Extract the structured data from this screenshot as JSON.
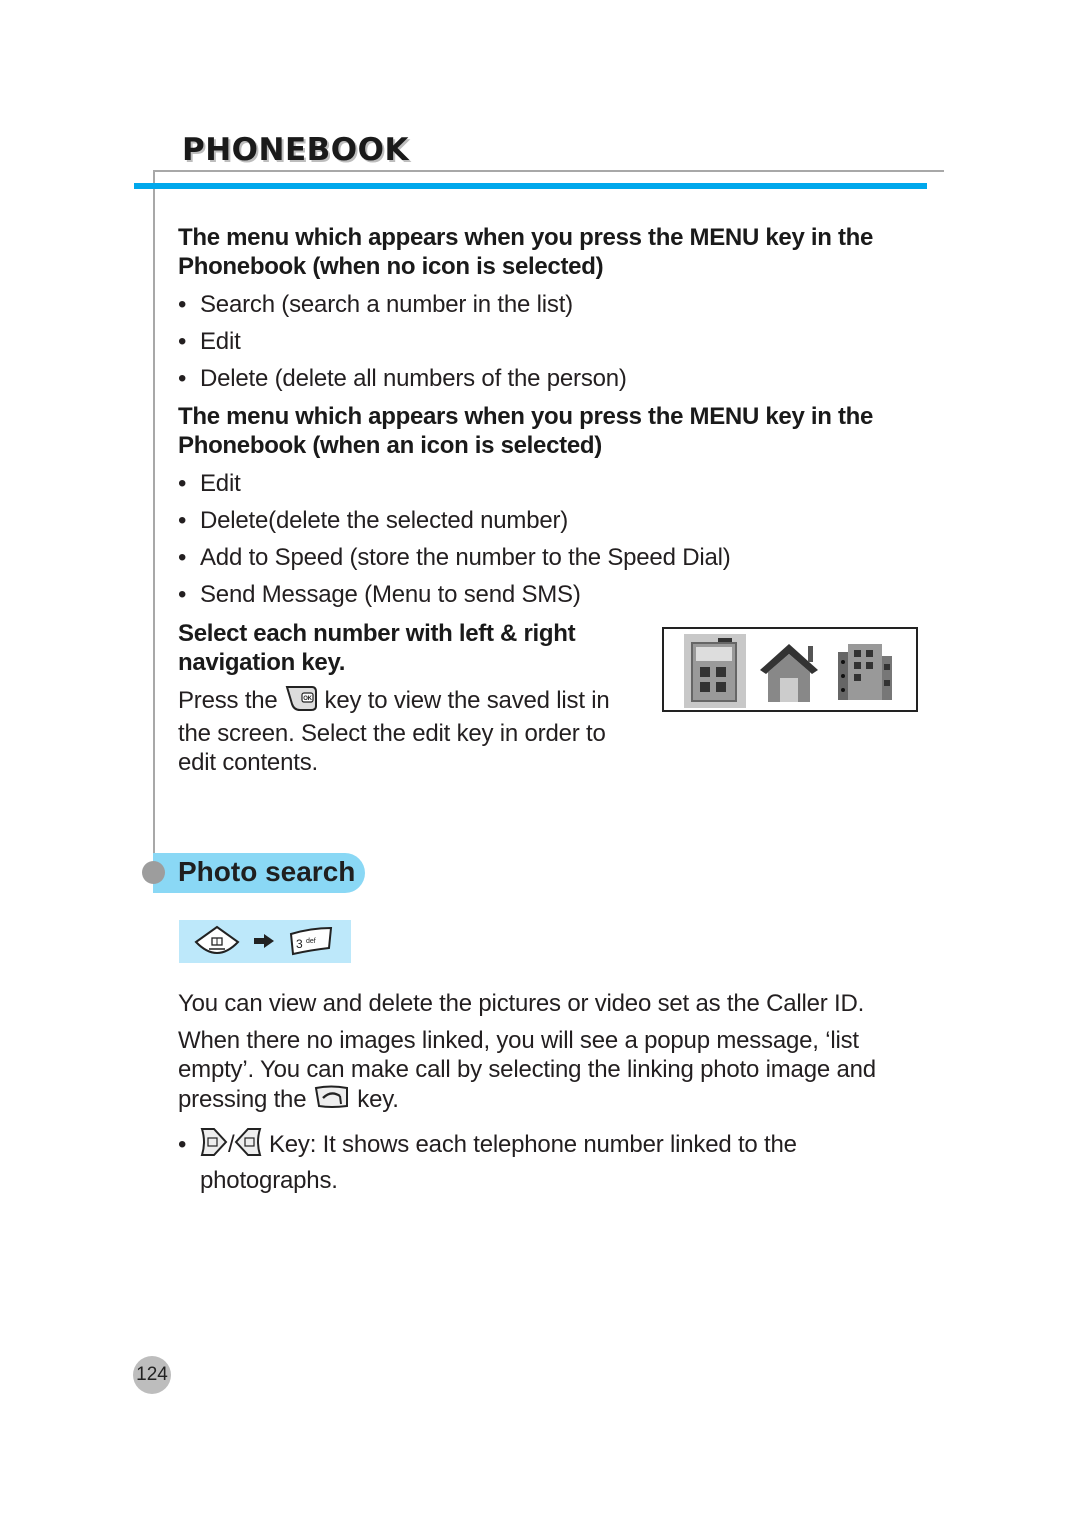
{
  "page": {
    "section_title": "PHONEBOOK",
    "page_number": "124",
    "colors": {
      "accent_blue": "#00a8ec",
      "pill_blue": "#8ad8f5",
      "keypath_bg": "#bde8fa",
      "rule_gray": "#a8a8a8"
    }
  },
  "menu_no_icon": {
    "heading_line1": "The menu which appears when you press the MENU key in the",
    "heading_line2": "Phonebook (when no icon is selected)",
    "items": [
      "Search (search a number in the list)",
      "Edit",
      "Delete (delete all numbers of the person)"
    ]
  },
  "menu_icon_selected": {
    "heading_line1": "The menu which appears when you press the MENU key in the",
    "heading_line2": "Phonebook (when an icon is selected)",
    "items": [
      "Edit",
      "Delete(delete the selected number)",
      "Add to Speed (store the number to the Speed Dial)",
      "Send Message (Menu to send SMS)"
    ]
  },
  "navigation": {
    "heading_line1": "Select each number with left & right",
    "heading_line2": "navigation key.",
    "text_before_icon": "Press the",
    "text_after_icon": "key to view the saved list in",
    "line2": "the screen. Select the edit key in order to",
    "line3": "edit contents.",
    "ok_key_icon": "ok-key-icon",
    "number_type_icons": [
      "mobile-phone-icon",
      "home-icon",
      "office-building-icon"
    ],
    "selected_icon": "mobile-phone-icon"
  },
  "photo_search": {
    "title": "Photo search",
    "key_path": [
      "menu-key-icon",
      "arrow-right-icon",
      "key-3-def-icon"
    ],
    "key_3_label": "3",
    "key_3_sub": "def",
    "para1": "You can view and delete the pictures or video set as the Caller ID.",
    "para2_line1": "When there no images linked, you will see a popup message, ‘list",
    "para2_line2": "empty’. You can make call by selecting the linking photo image and",
    "para2_before_icon": "pressing the",
    "para2_after_icon": "key.",
    "send_key_icon": "send-key-icon",
    "bullet_separator": "/",
    "bullet_text_line1": "Key: It shows each telephone number linked to the",
    "bullet_text_line2": "photographs.",
    "bullet_icons": [
      "left-nav-key-icon",
      "right-nav-key-icon"
    ]
  },
  "bullet_char": "•"
}
